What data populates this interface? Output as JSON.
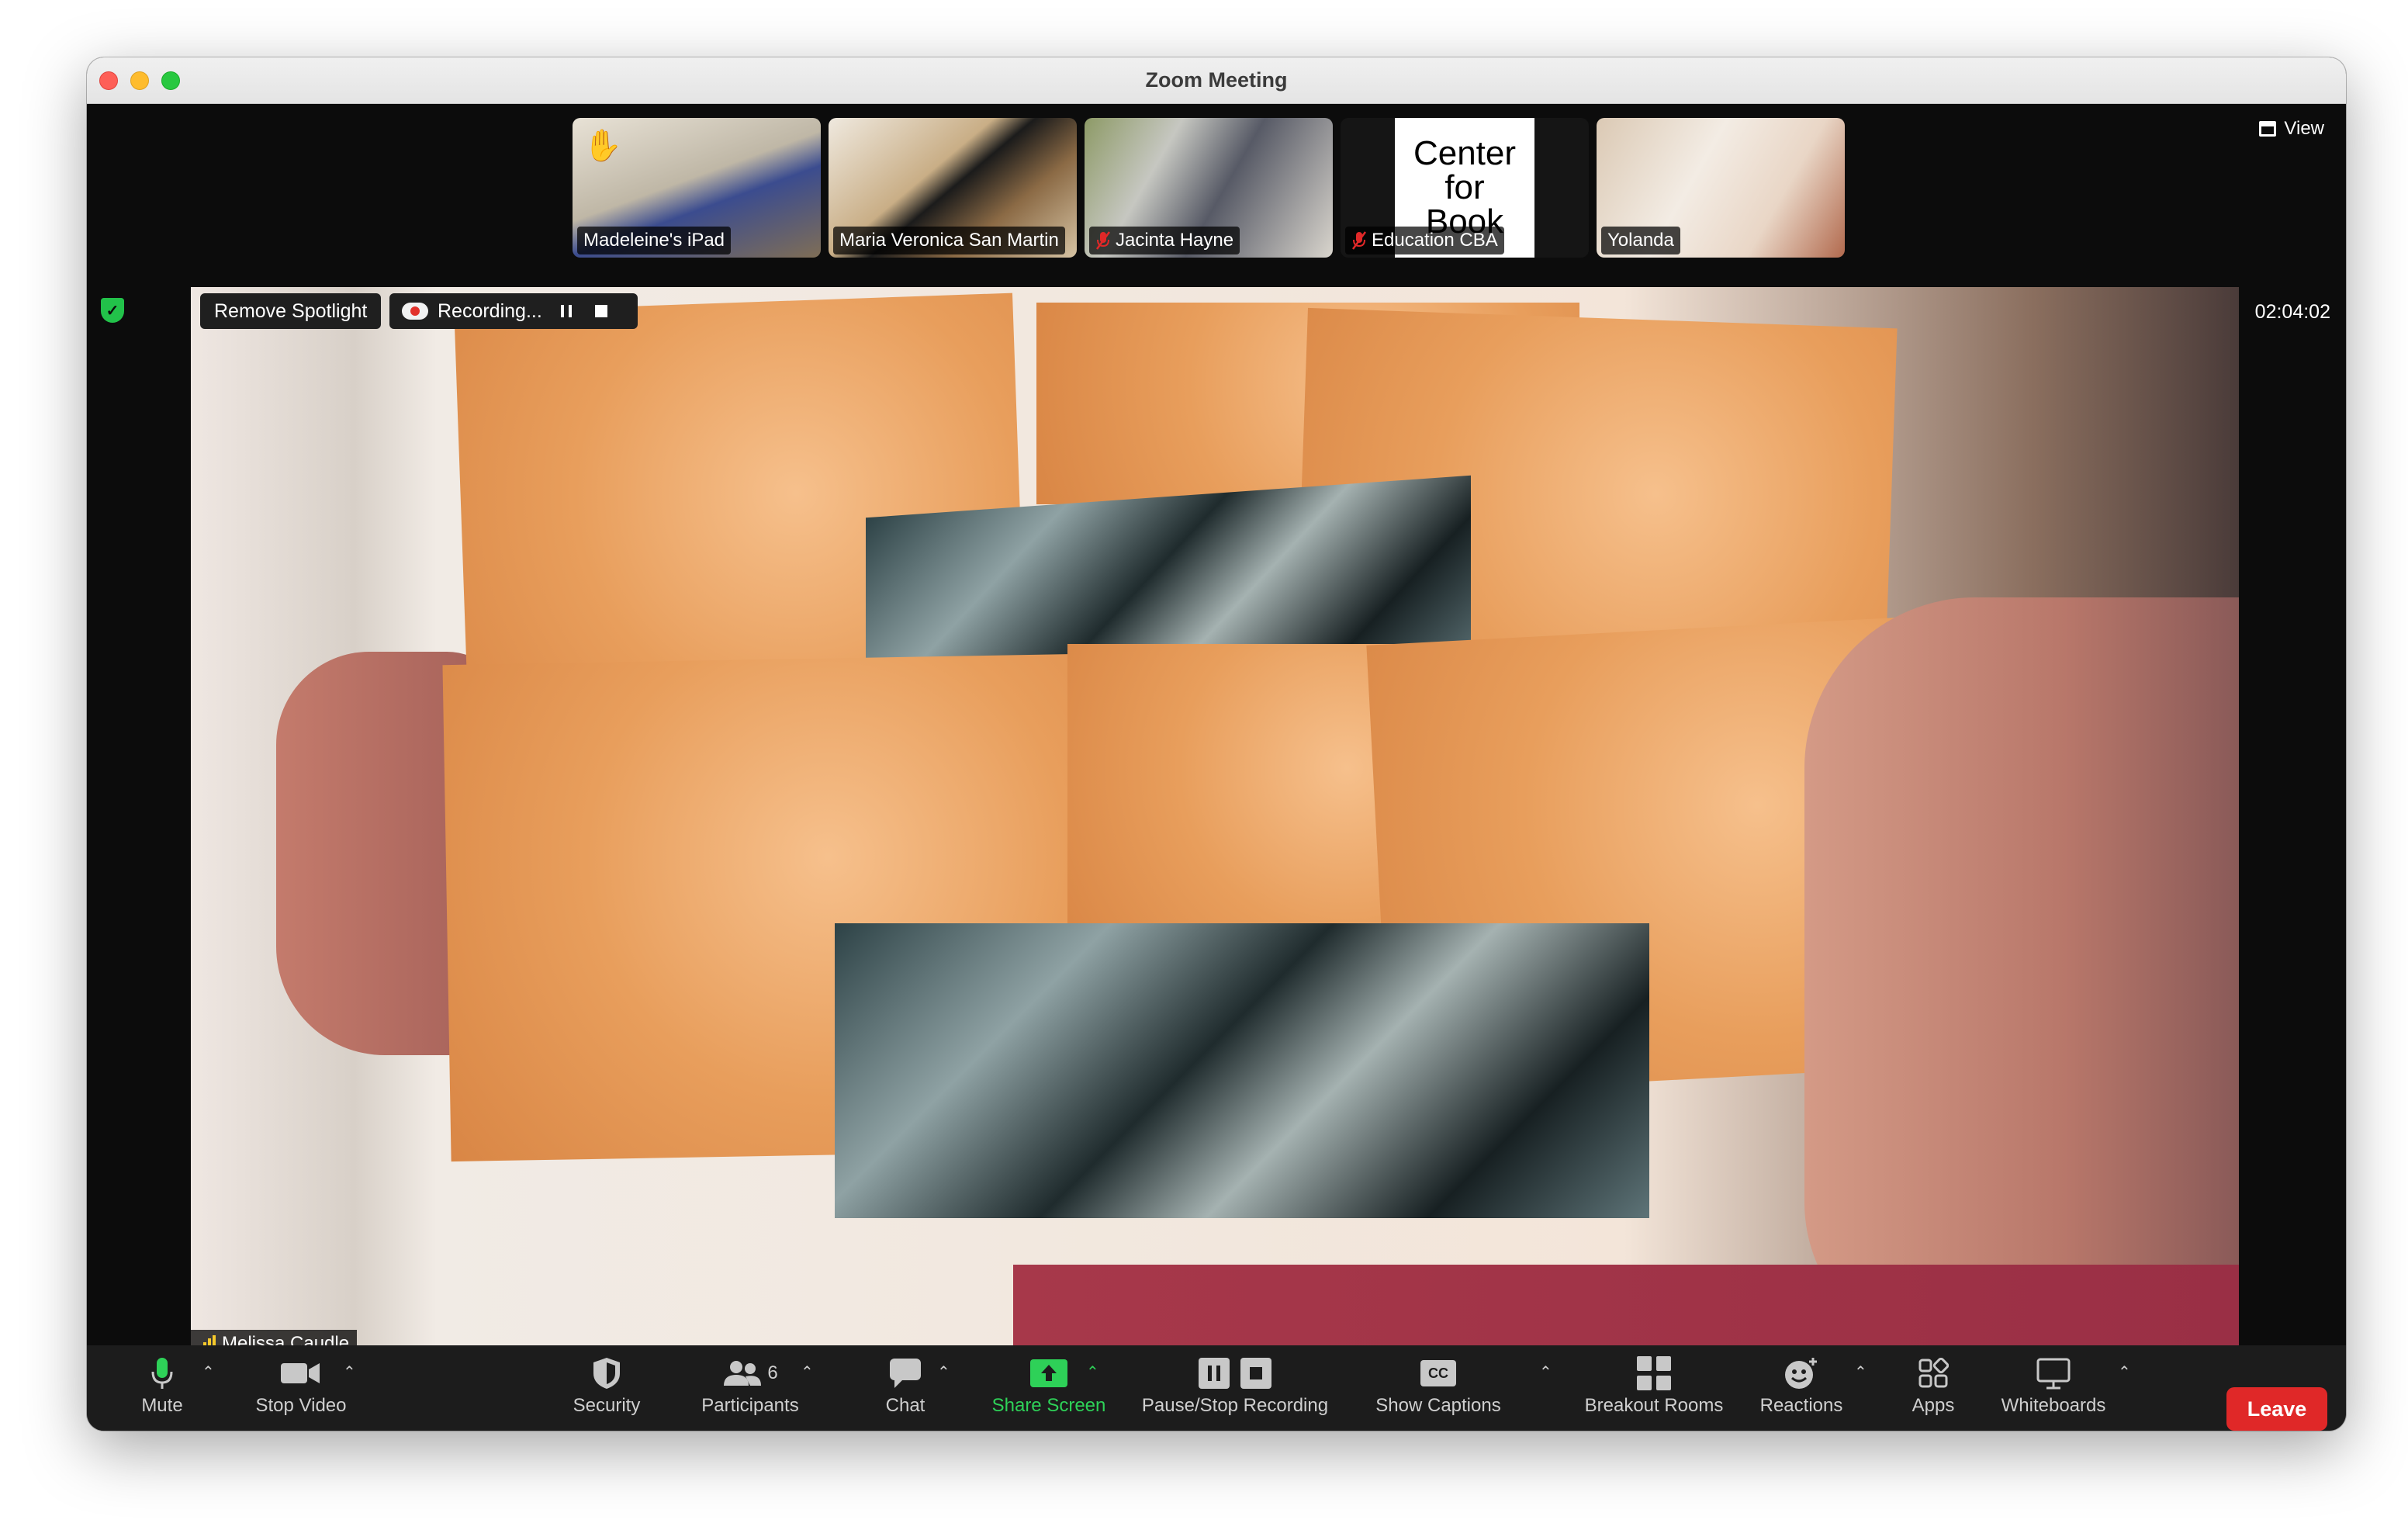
{
  "window": {
    "title": "Zoom Meeting"
  },
  "thumbnails": [
    {
      "name": "Madeleine's iPad",
      "muted": false,
      "hand_raised": true
    },
    {
      "name": "Maria Veronica San Martin",
      "muted": false
    },
    {
      "name": "Jacinta Hayne",
      "muted": true
    },
    {
      "name": "Education CBA",
      "muted": true,
      "card_text": [
        "Center",
        "for",
        "Book"
      ]
    },
    {
      "name": "Yolanda",
      "muted": false
    }
  ],
  "view_button": "View",
  "spotlight_button": "Remove Spotlight",
  "recording": {
    "label": "Recording..."
  },
  "timer": "02:04:02",
  "main_video": {
    "name": "Melissa Caudle"
  },
  "toolbar": {
    "mute": "Mute",
    "stop_video": "Stop Video",
    "security": "Security",
    "participants": "Participants",
    "participants_count": "6",
    "chat": "Chat",
    "share_screen": "Share Screen",
    "pause_stop_recording": "Pause/Stop Recording",
    "show_captions": "Show Captions",
    "captions_icon_text": "CC",
    "breakout_rooms": "Breakout Rooms",
    "reactions": "Reactions",
    "apps": "Apps",
    "whiteboards": "Whiteboards",
    "leave": "Leave"
  },
  "colors": {
    "share_green": "#2ed158",
    "leave_red": "#e02828",
    "spotlight_bg": "#1f1f1f",
    "signal_yellow": "#f6c92b"
  }
}
